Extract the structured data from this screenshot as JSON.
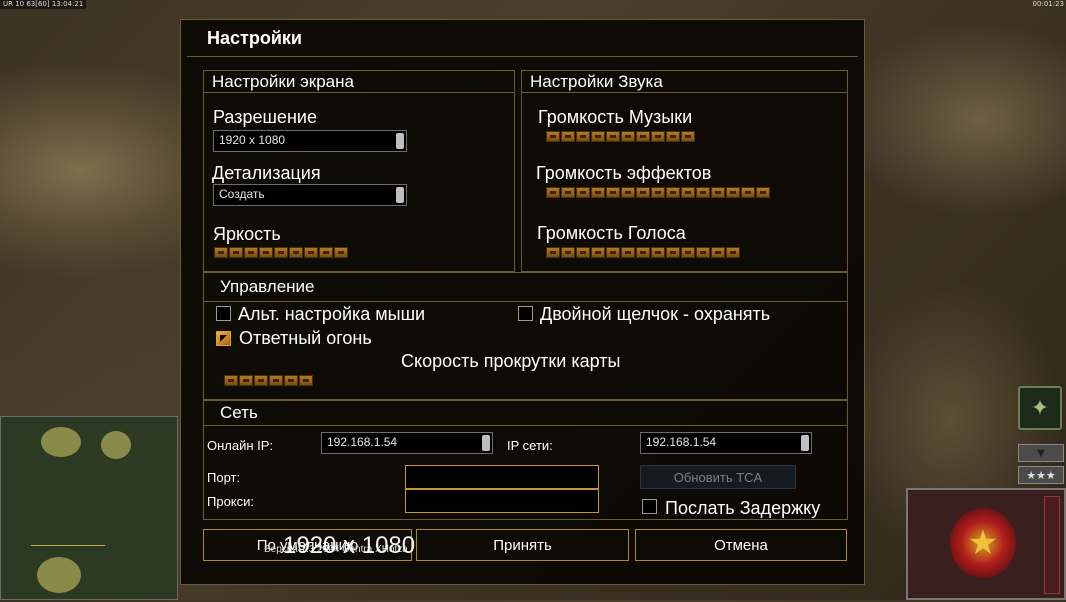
{
  "hud": {
    "top_left": "UR 10 63[60] 13:04:21",
    "top_right": "00:01:23"
  },
  "dialog": {
    "title": "Настройки",
    "screen": {
      "header": "Настройки экрана",
      "resolution_label": "Разрешение",
      "resolution_value": "1920 x 1080",
      "detail_label": "Детализация",
      "detail_value": "Создать",
      "brightness_label": "Яркость",
      "brightness_segments": 9
    },
    "sound": {
      "header": "Настройки Звука",
      "music_label": "Громкость Музыки",
      "music_segments": 10,
      "effects_label": "Громкость эффектов",
      "effects_segments": 15,
      "voice_label": "Громкость Голоса",
      "voice_segments": 13
    },
    "controls": {
      "header": "Управление",
      "alt_mouse_label": "Альт. настройка мыши",
      "alt_mouse_checked": false,
      "double_click_label": "Двойной щелчок - охранять",
      "double_click_checked": false,
      "return_fire_label": "Ответный огонь",
      "return_fire_checked": true,
      "scroll_speed_label": "Скорость прокрутки карты",
      "scroll_speed_segments": 6
    },
    "network": {
      "header": "Сеть",
      "online_ip_label": "Онлайн IP:",
      "online_ip_value": "192.168.1.54",
      "lan_ip_label": "IP сети:",
      "lan_ip_value": "192.168.1.54",
      "port_label": "Порт:",
      "proxy_label": "Прокси:",
      "update_button": "Обновить TCA",
      "send_delay_label": "Послать Задержку",
      "send_delay_checked": false
    },
    "buttons": {
      "defaults": "По умолчанию",
      "accept": "Принять",
      "cancel": "Отмена"
    },
    "version_text": "Версия 1.3 2004 Contra XHotza",
    "resolution_overlay": "1920 x 1080"
  }
}
